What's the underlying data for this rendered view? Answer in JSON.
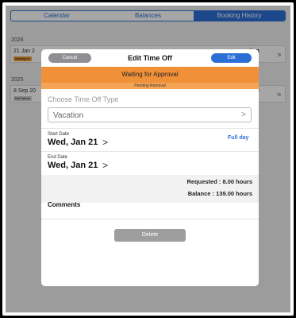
{
  "tabs": [
    {
      "label": "Calendar",
      "active": false
    },
    {
      "label": "Balances",
      "active": false
    },
    {
      "label": "Booking History",
      "active": true
    }
  ],
  "history": {
    "groups": [
      {
        "year": "2026",
        "date": "21 Jan 2",
        "tag": "Waiting for",
        "tag_color": "#f0a03a",
        "right": "tion",
        "right2": "ours"
      },
      {
        "year": "2025",
        "date": "8 Sep 20",
        "tag": "Not Submi",
        "tag_color": "#d0d0d0",
        "right": "tion",
        "right2": "ours"
      }
    ]
  },
  "modal": {
    "title": "Edit Time Off",
    "cancel_label": "Cancel",
    "edit_label": "Edit",
    "status": "Waiting for Approval",
    "substatus": "Pending Removal",
    "type_label": "Choose Time Off Type",
    "type_value": "Vacation",
    "start_label": "Start Date",
    "start_value": "Wed, Jan 21",
    "full_day": "Full day",
    "end_label": "End Date",
    "end_value": "Wed, Jan 21",
    "requested": "Requested : 8.00 hours",
    "balance": "Balance : 139.00 hours",
    "comments_label": "Comments",
    "delete_label": "Delete"
  },
  "colors": {
    "accent": "#2b6fd6",
    "status_banner": "#f0913a",
    "disabled_button": "#9e9e9e"
  }
}
